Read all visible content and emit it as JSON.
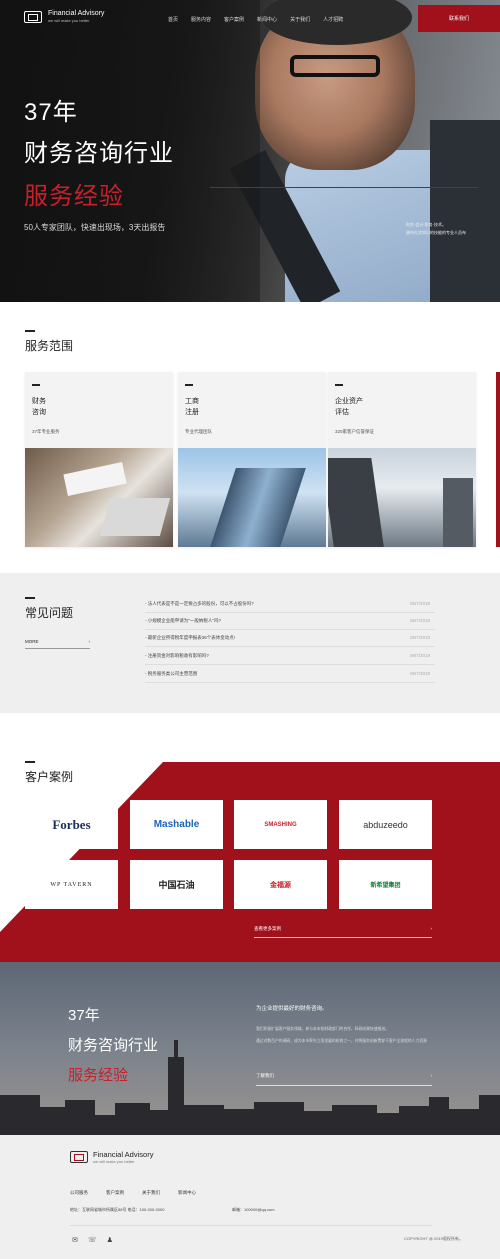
{
  "header": {
    "logo_title": "Financial Advisory",
    "logo_tagline": "we will make you better",
    "nav": [
      "首页",
      "服务内容",
      "客户案例",
      "新闻中心",
      "关于我们",
      "人才招聘"
    ],
    "contact_button": "联系我们"
  },
  "hero": {
    "line1": "37年",
    "line2": "财务咨询行业",
    "line3": "服务经验",
    "subtitle": "50人专家团队，快速出现场，3天出报告",
    "side_text": "财务·会计·税务·技术。\n遍布扎实知识的技能的专业人员布"
  },
  "services": {
    "title": "服务范围",
    "cards": [
      {
        "name": "财务\n咨询",
        "desc": "37年专业服务"
      },
      {
        "name": "工商\n注册",
        "desc": "专业代理团队"
      },
      {
        "name": "企业资产\n评估",
        "desc": "320家客户信誉保证"
      }
    ]
  },
  "faq": {
    "title": "常见问题",
    "more": "MORE",
    "more_arrow": "›",
    "items": [
      {
        "q": "- 法人代表是不是一定要占多的股份，可以不占股份吗?",
        "d": "06/7/2019"
      },
      {
        "q": "- 小规模企业能申请为\"一般纳税人\"吗?",
        "d": "06/7/2019"
      },
      {
        "q": "- 最新企业所得税年度申报表36个表体变动点!",
        "d": "06/7/2019"
      },
      {
        "q": "- 注册资金对影响税收有影响吗?",
        "d": "06/7/2019"
      },
      {
        "q": "- 税务服务类公司主营范围",
        "d": "06/7/2019"
      }
    ]
  },
  "cases": {
    "title": "客户案例",
    "logos": [
      "Forbes",
      "Mashable",
      "SMASHING",
      "abduzeedo",
      "WP TAVERN",
      "中国石油",
      "金福源",
      "新希望集团"
    ],
    "more": "查看更多案例",
    "more_arrow": "›"
  },
  "city": {
    "line1": "37年",
    "line2": "财务咨询行业",
    "line3": "服务经验",
    "heading": "为企业提供最好的财务咨询。",
    "para1": "我们积极扩展客户服务领域，参与本市各财政部门的合作，科研成果快速推进。",
    "para2": "通过对数百户的调研，成为本市率先立项发展的机构之一，并将服务创新贯穿于客户全流程的人力资源",
    "link": "了解我们",
    "link_arrow": "›"
  },
  "footer": {
    "logo_title": "Financial Advisory",
    "logo_tagline": "we will make you better",
    "nav": [
      "公司服务",
      "客户案例",
      "关于我们",
      "新闻中心"
    ],
    "address": "地址：互联网省城市所属区88号   电话：100-000-0000",
    "email": "邮箱：100000@qq.com",
    "copyright": "COPYRIGHT @ 2019版权所有。",
    "icons": [
      "✉",
      "☏",
      "♟"
    ]
  }
}
